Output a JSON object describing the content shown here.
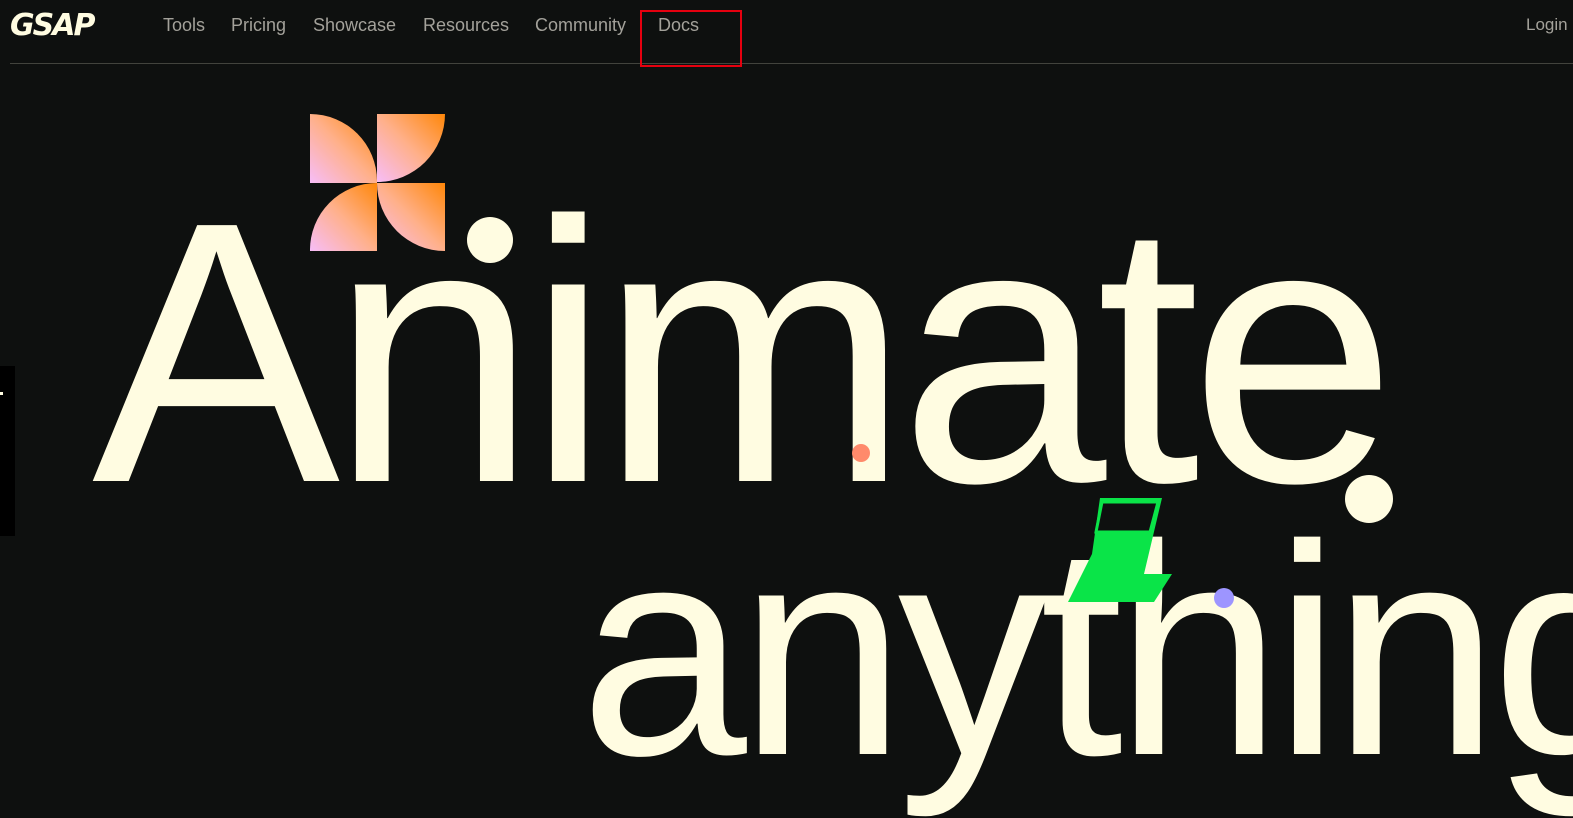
{
  "brand": {
    "logo": "GSAP"
  },
  "nav": {
    "items": [
      {
        "label": "Tools"
      },
      {
        "label": "Pricing"
      },
      {
        "label": "Showcase"
      },
      {
        "label": "Resources"
      },
      {
        "label": "Community"
      },
      {
        "label": "Docs"
      }
    ],
    "login": "Login"
  },
  "hero": {
    "word1": "Animate",
    "word2": "anything"
  },
  "colors": {
    "background": "#0e100f",
    "text_cream": "#fffce1",
    "nav_text": "#a3a19a",
    "pinwheel_orange": "#ff8709",
    "pinwheel_pink": "#f7bdf8",
    "bolt_green": "#0ae448",
    "highlight_red": "#e5000f"
  },
  "icons": {
    "logo": "gsap-logo",
    "pinwheel": "pinwheel-shape",
    "bolt": "lightning-bolt-shape"
  }
}
